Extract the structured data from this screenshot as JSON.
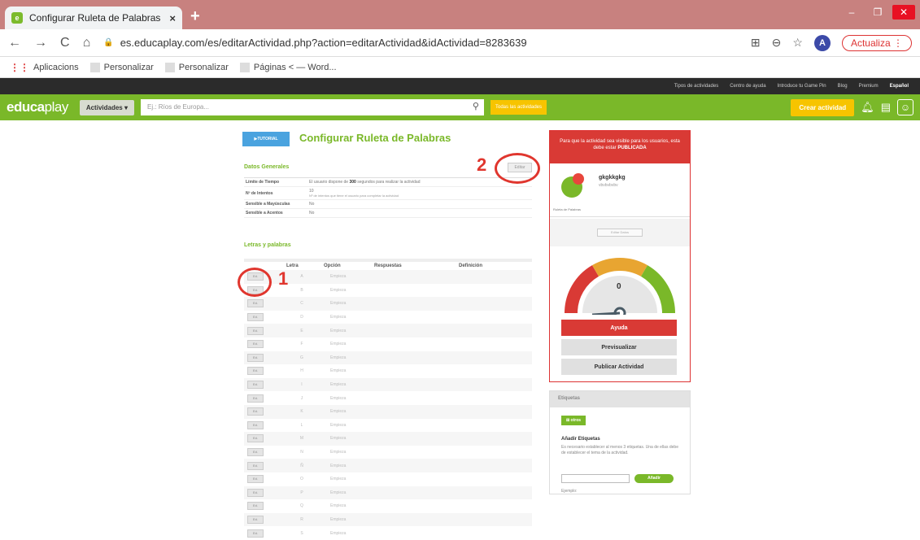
{
  "browser": {
    "tab_title": "Configurar Ruleta de Palabras - E",
    "tab_close": "×",
    "new_tab": "+",
    "url": "es.educaplay.com/es/editarActividad.php?action=editarActividad&idActividad=8283639",
    "profile_initial": "A",
    "update_label": "Actualiza",
    "bookmarks": [
      "Aplicacions",
      "Personalizar",
      "Personalizar",
      "Páginas < — Word..."
    ]
  },
  "site": {
    "topnav": [
      "Tipos de actividades",
      "Centro de ayuda",
      "Introduce tu Game Pin",
      "Blog",
      "Premium"
    ],
    "language": "Español",
    "logo_bold": "educa",
    "logo_light": "play",
    "activities_btn": "Actividades",
    "search_placeholder": "Ej.: Ríos de Europa...",
    "todas_btn": "Todas las actividades",
    "crear_btn": "Crear actividad"
  },
  "main": {
    "tutorial_btn": "TUTORIAL",
    "title": "Configurar Ruleta de Palabras",
    "datos_generales": "Datos Generales",
    "edit_btn": "Editar",
    "general_rows": [
      {
        "k": "Límite de Tiempo",
        "v_pre": "El usuario dispone de ",
        "v_bold": "300",
        "v_post": " segundos para realizar la actividad"
      },
      {
        "k": "Nº de Intentos",
        "v": "10",
        "note": "Nº de intentos que tiene el usuario para completar la actividad"
      },
      {
        "k": "Sensible a Mayúsculas",
        "v": "No"
      },
      {
        "k": "Sensible a Acentos",
        "v": "No"
      }
    ],
    "letras_head": "Letras y palabras",
    "columns": {
      "letra": "Letra",
      "opcion": "Opción",
      "respuestas": "Respuestas",
      "definicion": "Definición"
    },
    "row_btn": "Ed.",
    "row_option": "Empieza",
    "letters": [
      "A",
      "B",
      "C",
      "D",
      "E",
      "F",
      "G",
      "H",
      "I",
      "J",
      "K",
      "L",
      "M",
      "N",
      "Ñ",
      "O",
      "P",
      "Q",
      "R",
      "S"
    ]
  },
  "annotations": {
    "one": "1",
    "two": "2"
  },
  "right_panel": {
    "notice": "Para que la actividad sea visible para los usuarios, esta debe estar",
    "notice_bold": "PUBLICADA",
    "game_name": "gkgkkgkg",
    "game_sub": "vbvbvbvbv",
    "game_type": "Ruleta de Palabras",
    "edit_data": "Editar Datos",
    "gauge_value": "0",
    "gauge_level": 0,
    "ayuda": "Ayuda",
    "previsualizar": "Previsualizar",
    "publicar": "Publicar Actividad"
  },
  "tags": {
    "head": "Etiquetas",
    "otros": "otros",
    "sub": "Añadir Etiquetas",
    "desc": "Es necesario establecer al menos 3 etiquetas. Una de ellas debe de establecer el tema de la actividad.",
    "add": "Añadir",
    "example": "Ejemplo:"
  }
}
